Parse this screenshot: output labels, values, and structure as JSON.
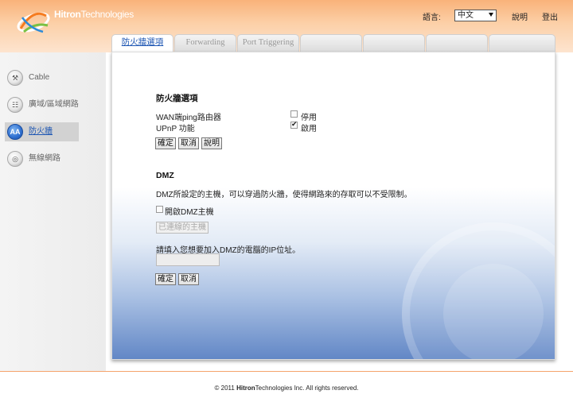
{
  "header": {
    "brand_bold": "Hitron",
    "brand_rest": "Technologies",
    "language_label": "語言:",
    "language_value": "中文",
    "help_link": "說明",
    "logout_link": "登出"
  },
  "tabs": [
    {
      "label": "防火牆選項",
      "active": true
    },
    {
      "label": "Forwarding",
      "active": false
    },
    {
      "label": "Port Triggering",
      "active": false
    },
    {
      "label": "",
      "active": false
    },
    {
      "label": "",
      "active": false
    },
    {
      "label": "",
      "active": false
    },
    {
      "label": "",
      "active": false
    }
  ],
  "sidebar": {
    "items": [
      {
        "label": "Cable",
        "icon": "wrench-icon",
        "glyph": "⚒",
        "active": false
      },
      {
        "label": "廣域/區域網路",
        "icon": "network-icon",
        "glyph": "☷",
        "active": false
      },
      {
        "label": "防火牆",
        "icon": "firewall-icon",
        "glyph": "AA",
        "active": true
      },
      {
        "label": "無線網路",
        "icon": "wireless-icon",
        "glyph": "◎",
        "active": false
      }
    ]
  },
  "firewall": {
    "title": "防火牆選項",
    "wan_ping_label": "WAN端ping路由器",
    "wan_ping_option": "停用",
    "wan_ping_checked": false,
    "upnp_label": "UPnP 功能",
    "upnp_option": "啟用",
    "upnp_checked": true,
    "ok_button": "確定",
    "cancel_button": "取消",
    "help_button": "說明"
  },
  "dmz": {
    "title": "DMZ",
    "description": "DMZ所設定的主機，可以穿過防火牆，使得網路來的存取可以不受限制。",
    "enable_label": "開啟DMZ主機",
    "enable_checked": false,
    "connected_hosts_button": "已連線的主機",
    "ip_prompt": "請填入您想要加入DMZ的電腦的IP位址。",
    "ip_value": "",
    "ok_button": "確定",
    "cancel_button": "取消"
  },
  "footer": {
    "copyright_prefix": "© 2011",
    "brand_bold": "Hitron",
    "brand_rest": "Technologies",
    "copyright_suffix": "Inc.  All rights reserved."
  },
  "colors": {
    "accent": "#f9b27a",
    "link_blue": "#1d56b3",
    "panel_gradient_end": "#6287c6"
  }
}
